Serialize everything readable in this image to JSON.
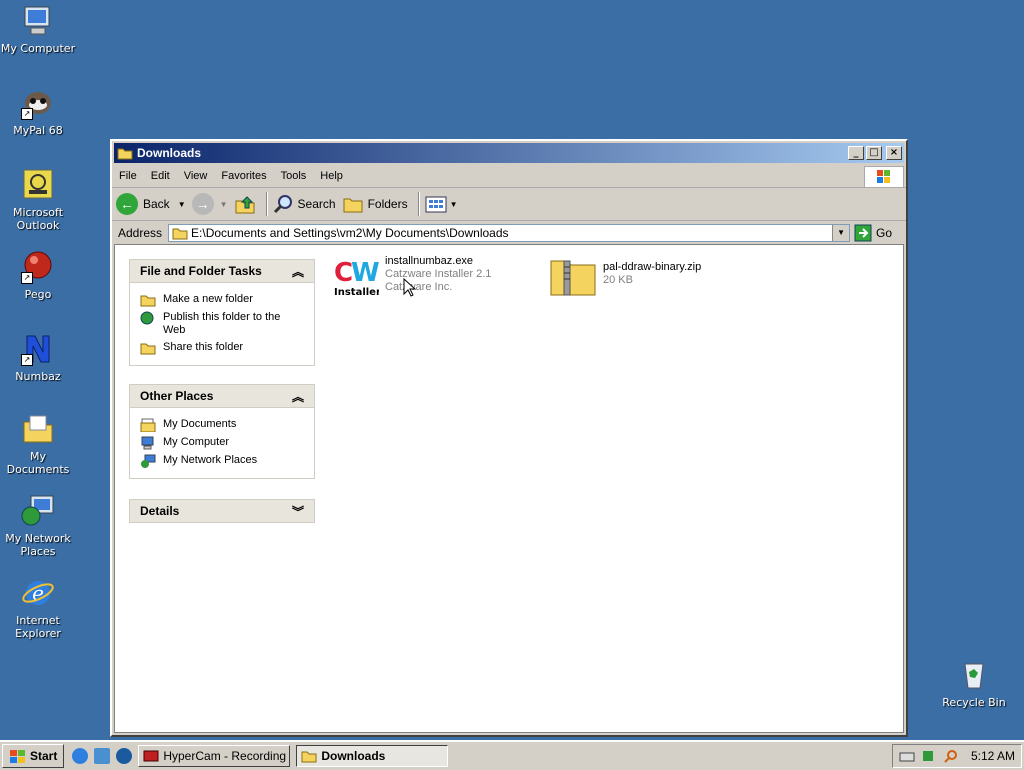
{
  "desktop": {
    "icons": [
      {
        "label": "My Computer"
      },
      {
        "label": "MyPal 68"
      },
      {
        "label": "Microsoft Outlook"
      },
      {
        "label": "Pego"
      },
      {
        "label": "Numbaz"
      },
      {
        "label": "My Documents"
      },
      {
        "label": "My Network Places"
      },
      {
        "label": "Internet Explorer"
      },
      {
        "label": "Recycle Bin"
      }
    ]
  },
  "window": {
    "title": "Downloads",
    "menu": [
      "File",
      "Edit",
      "View",
      "Favorites",
      "Tools",
      "Help"
    ],
    "toolbar": {
      "back": "Back",
      "search": "Search",
      "folders": "Folders"
    },
    "address": {
      "label": "Address",
      "value": "E:\\Documents and Settings\\vm2\\My Documents\\Downloads",
      "go": "Go"
    },
    "panes": [
      {
        "title": "File and Folder Tasks",
        "items": [
          "Make a new folder",
          "Publish this folder to the Web",
          "Share this folder"
        ]
      },
      {
        "title": "Other Places",
        "items": [
          "My Documents",
          "My Computer",
          "My Network Places"
        ]
      },
      {
        "title": "Details",
        "items": []
      }
    ],
    "files": [
      {
        "name": "installnumbaz.exe",
        "line2": "Catzware Installer 2.1",
        "line3": "Catzware Inc.",
        "icon": "cw-installer-icon"
      },
      {
        "name": "pal-ddraw-binary.zip",
        "line2": "20 KB",
        "icon": "zip-folder-icon"
      }
    ]
  },
  "taskbar": {
    "start": "Start",
    "tasks": [
      {
        "label": "HyperCam - Recording",
        "active": false
      },
      {
        "label": "Downloads",
        "active": true
      }
    ],
    "clock": "5:12 AM"
  },
  "colors": {
    "desktop": "#3a6ea5",
    "titlebar": "#0a246a"
  }
}
